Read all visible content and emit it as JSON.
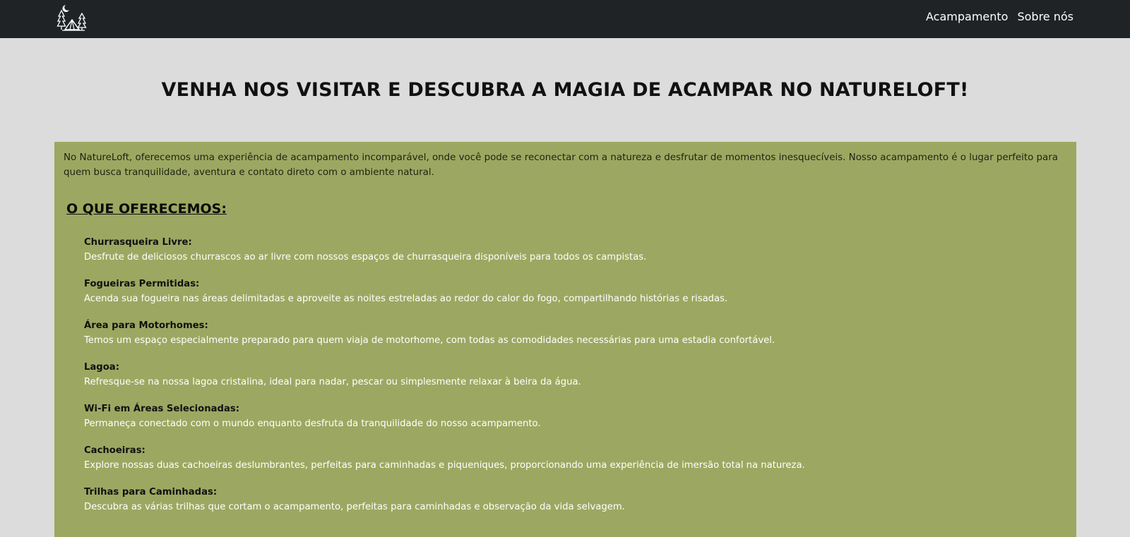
{
  "nav": {
    "logo_icon": "camping-tent-trees-moon-icon",
    "links": [
      "Acampamento",
      "Sobre nós"
    ]
  },
  "hero": {
    "title": "VENHA NOS VISITAR E DESCUBRA A MAGIA DE ACAMPAR NO NATURELOFT!"
  },
  "intro": "No NatureLoft, oferecemos uma experiência de acampamento incomparável, onde você pode se reconectar com a natureza e desfrutar de momentos inesquecíveis. Nosso acampamento é o lugar perfeito para quem busca tranquilidade, aventura e contato direto com o ambiente natural.",
  "offers": {
    "title": "O QUE OFERECEMOS:",
    "items": [
      {
        "name": "Churrasqueira Livre:",
        "desc": "Desfrute de deliciosos churrascos ao ar livre com nossos espaços de churrasqueira disponíveis para todos os campistas."
      },
      {
        "name": "Fogueiras Permitidas:",
        "desc": "Acenda sua fogueira nas áreas delimitadas e aproveite as noites estreladas ao redor do calor do fogo, compartilhando histórias e risadas."
      },
      {
        "name": "Área para Motorhomes:",
        "desc": "Temos um espaço especialmente preparado para quem viaja de motorhome, com todas as comodidades necessárias para uma estadia confortável."
      },
      {
        "name": "Lagoa:",
        "desc": "Refresque-se na nossa lagoa cristalina, ideal para nadar, pescar ou simplesmente relaxar à beira da água."
      },
      {
        "name": "Wi-Fi em Áreas Selecionadas:",
        "desc": "Permaneça conectado com o mundo enquanto desfruta da tranquilidade do nosso acampamento."
      },
      {
        "name": "Cachoeiras:",
        "desc": "Explore nossas duas cachoeiras deslumbrantes, perfeitas para caminhadas e piqueniques, proporcionando uma experiência de imersão total na natureza."
      },
      {
        "name": "Trilhas para Caminhadas:",
        "desc": "Descubra as várias trilhas que cortam o acampamento, perfeitas para caminhadas e observação da vida selvagem."
      }
    ]
  },
  "colors": {
    "navbar": "#1f2326",
    "page_background": "#dcdcdc",
    "panel": "#9ca861"
  }
}
